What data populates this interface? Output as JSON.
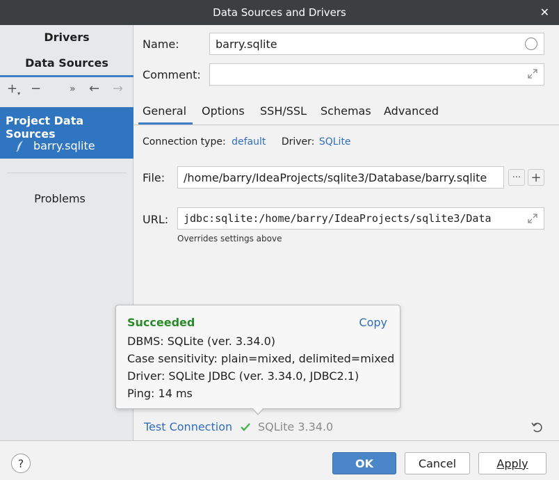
{
  "window": {
    "title": "Data Sources and Drivers",
    "close_glyph": "✕"
  },
  "sidebar": {
    "nav_drivers": "Drivers",
    "nav_data_sources": "Data Sources",
    "toolbar": {
      "add": "+",
      "remove": "−",
      "more": "»",
      "back": "←",
      "forward": "→"
    },
    "group_header": "Project Data Sources",
    "selected_item": "barry.sqlite",
    "problems": "Problems"
  },
  "form": {
    "name_label": "Name:",
    "name_value": "barry.sqlite",
    "comment_label": "Comment:",
    "comment_value": ""
  },
  "tabs": [
    "General",
    "Options",
    "SSH/SSL",
    "Schemas",
    "Advanced"
  ],
  "general": {
    "connection_type_label": "Connection type:",
    "connection_type_value": "default",
    "driver_label": "Driver:",
    "driver_value": "SQLite",
    "file_label": "File:",
    "file_value": "/home/barry/IdeaProjects/sqlite3/Database/barry.sqlite",
    "file_more": "···",
    "file_add": "+",
    "url_label": "URL:",
    "url_value": "jdbc:sqlite:/home/barry/IdeaProjects/sqlite3/Data",
    "url_hint": "Overrides settings above"
  },
  "popup": {
    "status": "Succeeded",
    "copy": "Copy",
    "lines": [
      "DBMS: SQLite (ver. 3.34.0)",
      "Case sensitivity: plain=mixed, delimited=mixed",
      "Driver: SQLite JDBC (ver. 3.34.0, JDBC2.1)",
      "Ping: 14 ms"
    ]
  },
  "test_connection": {
    "label": "Test Connection",
    "result": "SQLite 3.34.0"
  },
  "footer": {
    "help": "?",
    "ok": "OK",
    "cancel": "Cancel",
    "apply": "Apply"
  },
  "colors": {
    "accent": "#3d7ec4",
    "selection": "#2f75c0",
    "success": "#2a8a2a",
    "link": "#2f6dbc",
    "titlebar": "#3c3f41"
  }
}
